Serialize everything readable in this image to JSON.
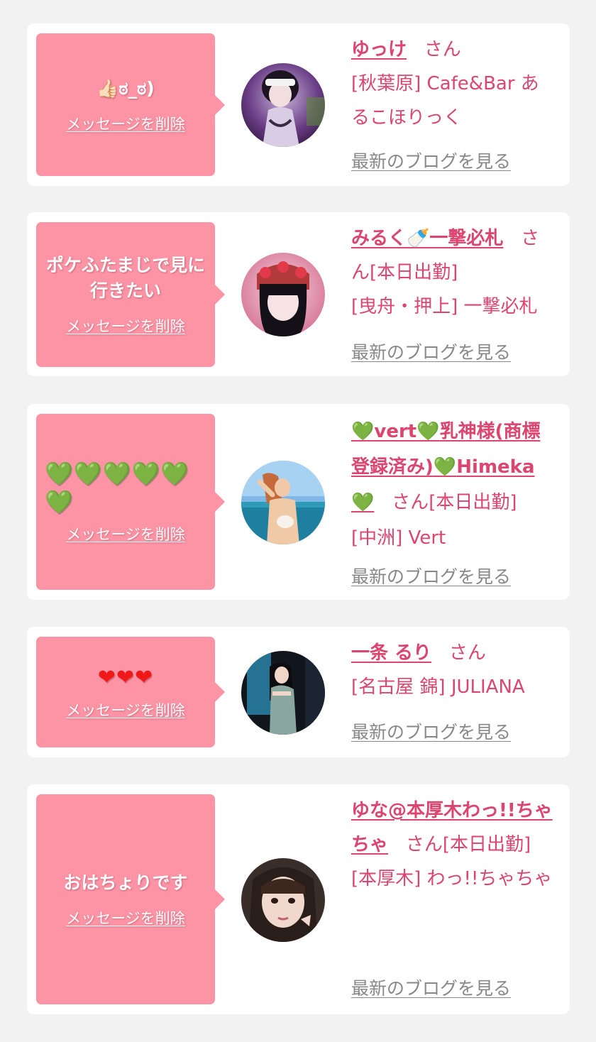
{
  "cards": [
    {
      "message": "👍🏻ಠ_ಠ)",
      "delete_label": "メッセージを削除",
      "name": "ゆっけ",
      "honorific": "さん",
      "shop": "[秋葉原] Cafe&Bar あるこほりっく",
      "blog_label": "最新のブログを見る"
    },
    {
      "message": "ポケふたまじで見に行きたい",
      "delete_label": "メッセージを削除",
      "name": "みるく🍼一撃必札",
      "honorific": "さん",
      "status": "[本日出勤]",
      "shop": "[曳舟・押上] 一撃必札",
      "blog_label": "最新のブログを見る"
    },
    {
      "message": "💚💚💚💚💚💚",
      "delete_label": "メッセージを削除",
      "name_heart": "💚",
      "name_part1": "vert",
      "name_part2": "乳神様(商標登録済み)",
      "name_part3": "Himeka",
      "honorific": "さん",
      "status": "[本日出勤]",
      "shop": "[中洲] Vert",
      "blog_label": "最新のブログを見る"
    },
    {
      "message": "❤❤❤",
      "delete_label": "メッセージを削除",
      "name": "一条 るり",
      "honorific": "さん",
      "shop": "[名古屋 錦] JULIANA",
      "blog_label": "最新のブログを見る"
    },
    {
      "message": "おはちょりです",
      "delete_label": "メッセージを削除",
      "name": "ゆな@本厚木わっ!!ちゃちゃ",
      "honorific": "さん",
      "status": "[本日出勤]",
      "shop": "[本厚木] わっ!!ちゃちゃ",
      "blog_label": "最新のブログを見る"
    }
  ],
  "colors": {
    "background": "#f2f2f2",
    "card": "#ffffff",
    "bubble": "#fd94a5",
    "accent_text": "#dc4570",
    "link_gray": "#888888",
    "green_heart": "#14b43c",
    "red_heart": "#f01818"
  },
  "icons": {
    "bubble_pointer": "speech-bubble-pointer",
    "avatar": "profile-photo"
  }
}
